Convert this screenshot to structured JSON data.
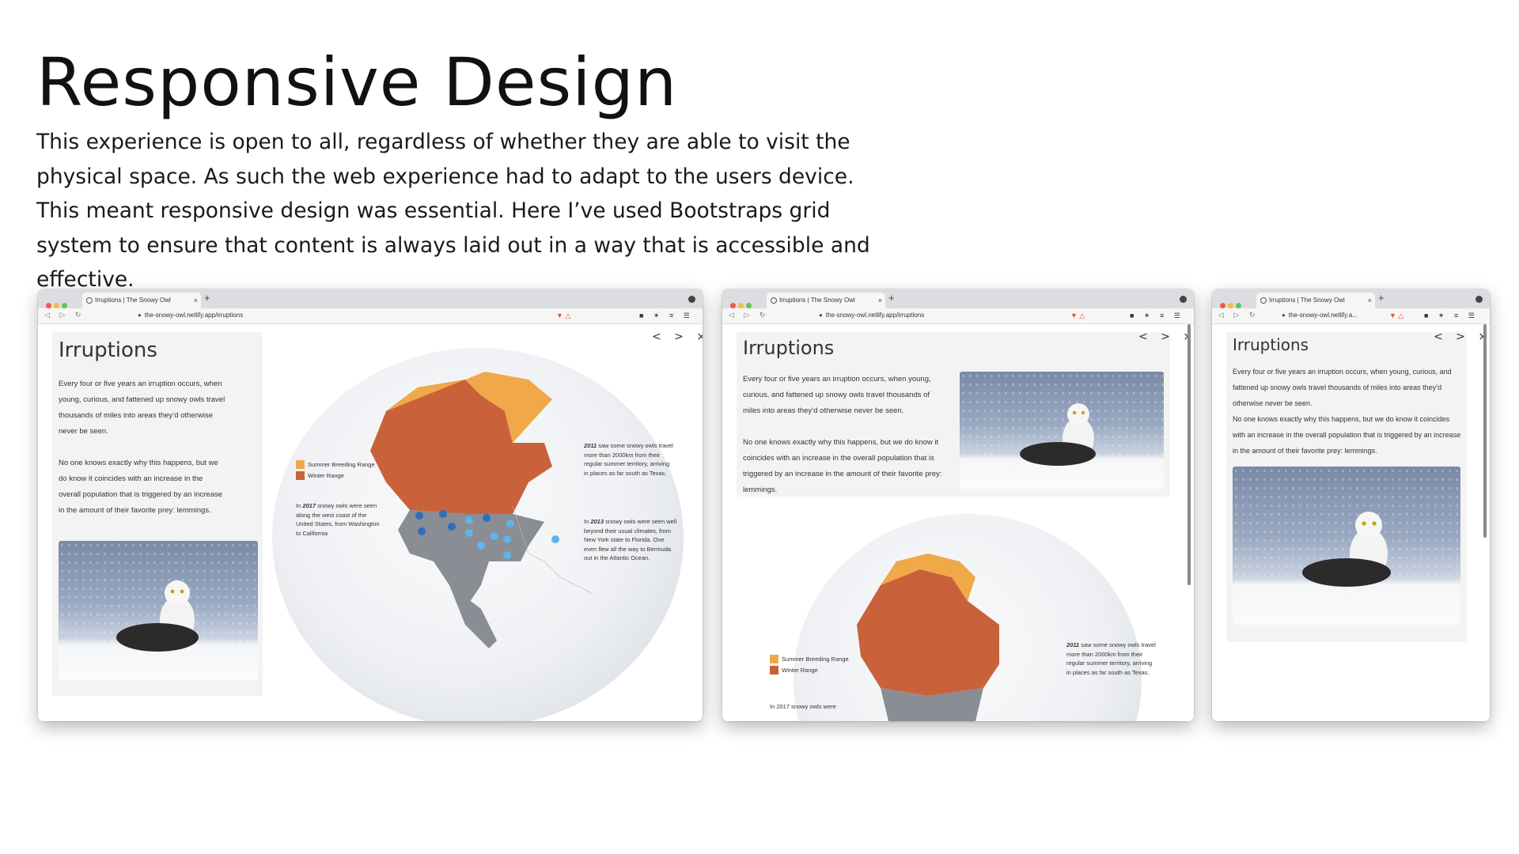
{
  "slide": {
    "title": "Responsive Design",
    "intro": "This experience is open to all, regardless of whether they are able to visit the physical space. As such the web experience had to adapt to the users device. This meant responsive design was essential. Here I’ve used Bootstraps grid system to ensure that content is always laid out in a way that is accessible and effective."
  },
  "browser": {
    "tab_title": "Irruptions | The Snowy Owl",
    "url": "the-snowy-owl.netlify.app/irruptions",
    "url_short": "the-snowy-owl.netlify.a...",
    "tab_close": "×",
    "new_tab": "+",
    "nav_icons": "◁ ▷ ↻",
    "brave_icons": "▼ △",
    "extension_icons": "■ ✶ ≡ ☰"
  },
  "page": {
    "heading": "Irruptions",
    "para1": "Every four or five years an irruption occurs, when young, curious, and fattened up snowy owls travel thousands of miles into areas they’d otherwise never be seen.",
    "para2": "No one knows exactly why this happens, but we do know it coincides with an increase in the overall population that is triggered by an increase in the amount of their favorite prey: lemmings.",
    "controls": "< > ×",
    "legend": [
      "Summer Breeding Range",
      "Winter Range"
    ],
    "note_2017_year": "2017",
    "note_2017_lead": "In ",
    "note_2017_rest": " snowy owls were seen along the west coast of the United States, from Washington to California",
    "note_2011_year": "2011",
    "note_2011_rest": " saw some snowy owls travel more than 2000km from their regular summer territory, arriving in places as far south as Texas.",
    "note_2013_lead": "In ",
    "note_2013_year": "2013",
    "note_2013_rest": " snowy owls were seen well beyond their usual climates, from New York state to Florida. One even flew all the way to Bermuda out in the Atlantic Ocean.",
    "note_2017_cut": "In 2017 snowy owls were"
  },
  "colors": {
    "summer_range": "#f0a848",
    "winter_range": "#c9623a",
    "land_grey": "#8a8d93",
    "sighting_dark": "#2d6fb8",
    "sighting_light": "#5fb4ea"
  }
}
